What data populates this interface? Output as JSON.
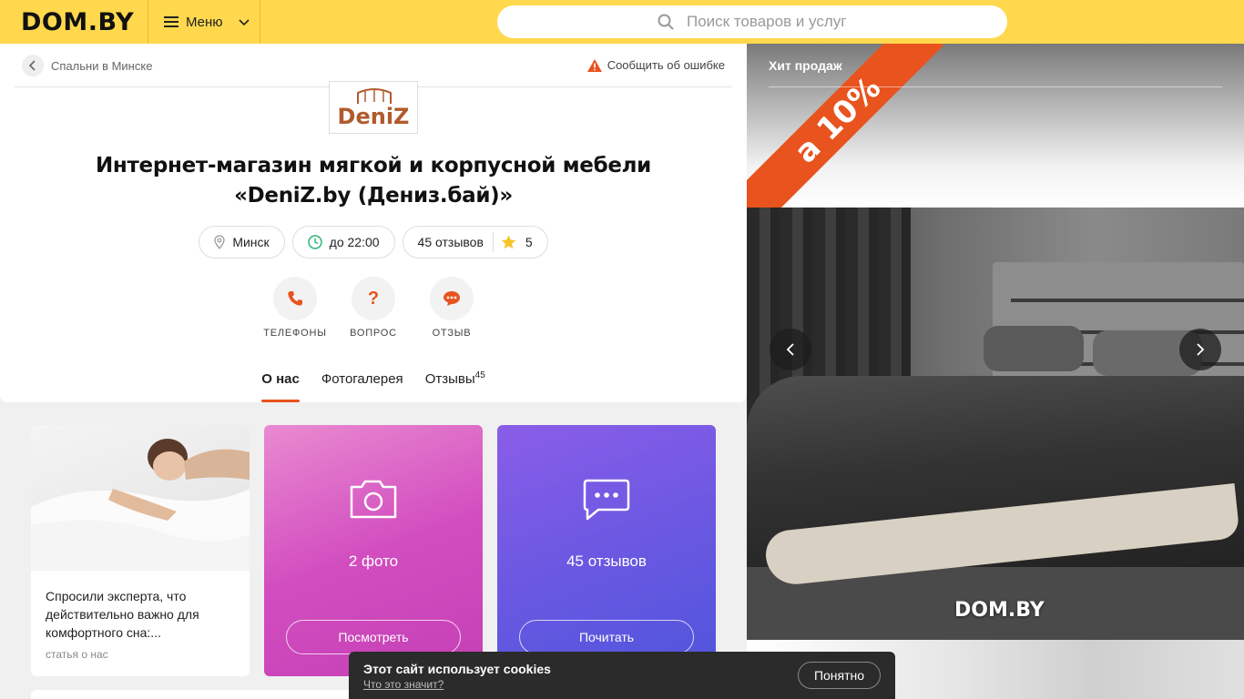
{
  "header": {
    "logo": "DOM.BY",
    "menu_label": "Меню",
    "search_placeholder": "Поиск товаров и услуг"
  },
  "breadcrumb": {
    "label": "Спальни в Минске"
  },
  "report_label": "Сообщить об ошибке",
  "company": {
    "logo_text": "DeniZ",
    "title": "Интернет-магазин мягкой и корпусной мебели «DeniZ.by (Дениз.бай)»",
    "city": "Минск",
    "hours": "до 22:00",
    "reviews_chip": "45 отзывов",
    "rating": "5"
  },
  "actions": [
    {
      "label": "ТЕЛЕФОНЫ",
      "icon": "phone-icon"
    },
    {
      "label": "ВОПРОС",
      "icon": "question-icon"
    },
    {
      "label": "ОТЗЫВ",
      "icon": "chat-icon"
    }
  ],
  "tabs": [
    {
      "label": "О нас",
      "active": true
    },
    {
      "label": "Фотогалерея",
      "active": false
    },
    {
      "label": "Отзывы",
      "count": "45",
      "active": false
    }
  ],
  "tiles": {
    "article": {
      "text": "Спросили эксперта, что действительно важно для комфортного сна:...",
      "tag": "статья о нас"
    },
    "photos": {
      "count_text": "2 фото",
      "button": "Посмотреть",
      "icon": "camera-icon"
    },
    "reviews": {
      "count_text": "45 отзывов",
      "button": "Почитать",
      "icon": "message-icon"
    }
  },
  "promo": {
    "label": "Хит продаж",
    "banner_text": "а 10%",
    "watermark": "DOM.BY"
  },
  "cookie": {
    "title": "Этот сайт использует cookies",
    "link": "Что это значит?",
    "button": "Понятно"
  },
  "colors": {
    "header_bg": "#ffd84d",
    "accent": "#e8531e",
    "photo_tile": "#d24ec0",
    "reviews_tile": "#6b58e2"
  }
}
